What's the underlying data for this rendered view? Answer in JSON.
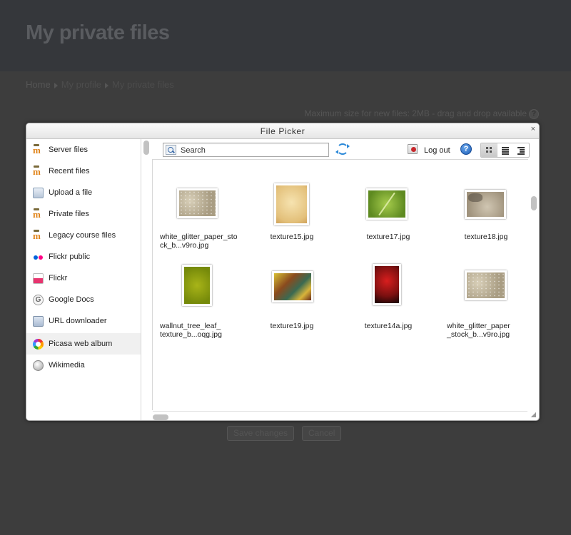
{
  "page": {
    "title": "My private files",
    "breadcrumb": [
      "Home",
      "My profile",
      "My private files"
    ],
    "max_size_text": "Maximum size for new files: 2MB - drag and drop available",
    "help_glyph": "?",
    "save_label": "Save changes",
    "cancel_label": "Cancel"
  },
  "dialog": {
    "title": "File Picker",
    "close_glyph": "×"
  },
  "sidebar": {
    "items": [
      {
        "label": "Server files",
        "icon": "moodle-icon"
      },
      {
        "label": "Recent files",
        "icon": "moodle-icon"
      },
      {
        "label": "Upload a file",
        "icon": "upload-icon"
      },
      {
        "label": "Private files",
        "icon": "moodle-icon"
      },
      {
        "label": "Legacy course files",
        "icon": "moodle-icon"
      },
      {
        "label": "Flickr public",
        "icon": "flickr-icon"
      },
      {
        "label": "Flickr",
        "icon": "flickr-icon"
      },
      {
        "label": "Google Docs",
        "icon": "google-icon"
      },
      {
        "label": "URL downloader",
        "icon": "url-downloader-icon"
      },
      {
        "label": "Picasa web album",
        "icon": "picasa-icon",
        "active": true
      },
      {
        "label": "Wikimedia",
        "icon": "wikimedia-icon"
      }
    ]
  },
  "toolbar": {
    "search_placeholder": "Search",
    "logout_label": "Log out",
    "help_glyph": "?"
  },
  "files": [
    {
      "name": "white_glitter_paper_stock_b...v9ro.jpg",
      "texture": "glitter"
    },
    {
      "name": "texture15.jpg",
      "texture": "paper"
    },
    {
      "name": "texture17.jpg",
      "texture": "leaf"
    },
    {
      "name": "texture18.jpg",
      "texture": "stone"
    },
    {
      "name": "wallnut_tree_leaf_ texture_b...oqg.jpg",
      "texture": "walnut"
    },
    {
      "name": "texture19.jpg",
      "texture": "grunge"
    },
    {
      "name": "texture14a.jpg",
      "texture": "red"
    },
    {
      "name": "white_glitter_paper _stock_b...v9ro.jpg",
      "texture": "glitter"
    }
  ]
}
